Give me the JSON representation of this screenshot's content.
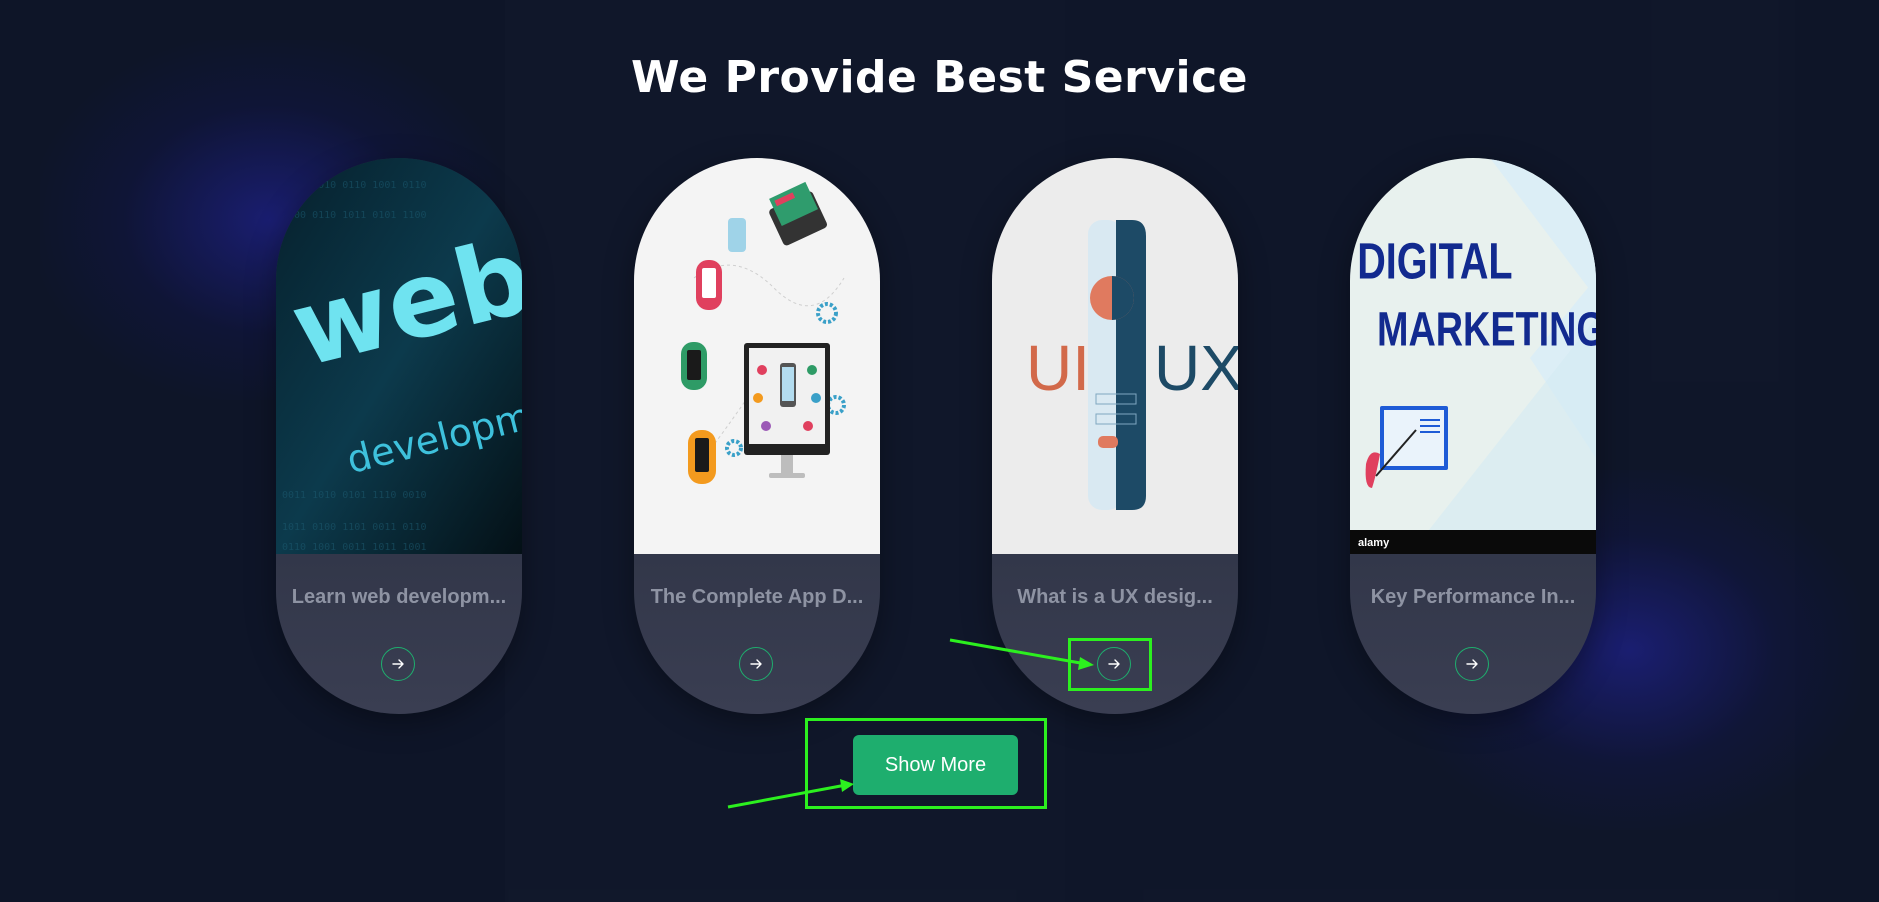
{
  "section": {
    "title": "We Provide Best Service"
  },
  "cards": [
    {
      "title": "Learn web developm...",
      "image_text": [
        "web",
        "development"
      ]
    },
    {
      "title": "The Complete App D...",
      "image_text": []
    },
    {
      "title": "What is a UX desig...",
      "image_text": [
        "UI",
        "UX"
      ]
    },
    {
      "title": "Key Performance In...",
      "image_text": [
        "DIGITAL",
        "MARKETING",
        "alamy"
      ]
    }
  ],
  "actions": {
    "show_more_label": "Show More"
  },
  "colors": {
    "background": "#0e1528",
    "accent": "#1eae6e",
    "annotation": "#2cf01f",
    "card_title": "#8e93a3"
  }
}
